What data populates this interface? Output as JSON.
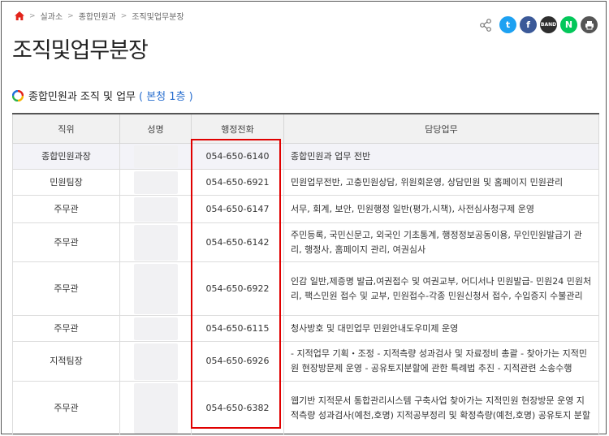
{
  "breadcrumb": [
    "실과소",
    "종합민원과",
    "조직및업무분장"
  ],
  "page_title": "조직및업무분장",
  "section": {
    "title": "종합민원과 조직 및 업무",
    "floor": "( 본청 1층 )"
  },
  "share": {
    "twitter": "t",
    "facebook": "f",
    "band": "BAND",
    "naver": "N"
  },
  "table": {
    "headers": [
      "직위",
      "성명",
      "행정전화",
      "담당업무"
    ],
    "rows": [
      {
        "position": "종합민원과장",
        "phone": "054-650-6140",
        "duty": "종합민원과 업무 전반"
      },
      {
        "position": "민원팀장",
        "phone": "054-650-6921",
        "duty": "민원업무전반, 고충민원상담, 위원회운영, 상담민원 및 홈페이지 민원관리"
      },
      {
        "position": "주무관",
        "phone": "054-650-6147",
        "duty": "서무, 회계, 보안, 민원행정 일반(평가,시책), 사전심사청구제 운영"
      },
      {
        "position": "주무관",
        "phone": "054-650-6142",
        "duty": "주민등록, 국민신문고, 외국인 기초통계, 행정정보공동이용, 무인민원발급기 관리, 행정사, 홈페이지 관리, 여권심사"
      },
      {
        "position": "주무관",
        "phone": "054-650-6922",
        "duty": "인감 일반,제증명 발급,여권접수 및 여권교부, 어디서나 민원발급- 민원24 민원처리, 팩스민원 접수 및 교부, 민원접수-각종 민원신청서 접수, 수입증지 수불관리"
      },
      {
        "position": "주무관",
        "phone": "054-650-6115",
        "duty": "청사방호 및 대민업무 민원안내도우미제 운영"
      },
      {
        "position": "지적팀장",
        "phone": "054-650-6926",
        "duty": "- 지적업무 기획・조정 - 지적측량 성과검사 및 자료정비 총괄 - 찾아가는 지적민원 현장방문제 운영 - 공유토지분할에 관한 특례법 추진 - 지적관련 소송수행"
      },
      {
        "position": "주무관",
        "phone": "054-650-6382",
        "duty": "웹기반 지적문서 통합관리시스템 구축사업 찾아가는 지적민원 현장방문 운영 지적측량 성과검사(예천,호명) 지적공부정리 및 확정측량(예천,호명) 공유토지 분할"
      }
    ]
  }
}
